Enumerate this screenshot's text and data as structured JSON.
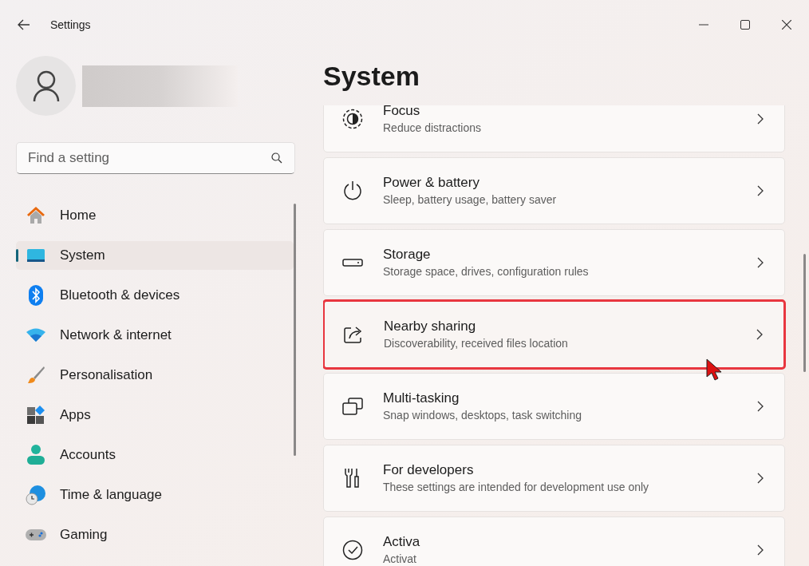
{
  "window": {
    "title": "Settings"
  },
  "search": {
    "placeholder": "Find a setting"
  },
  "sidebar": {
    "items": [
      {
        "label": "Home",
        "selected": false
      },
      {
        "label": "System",
        "selected": true
      },
      {
        "label": "Bluetooth & devices",
        "selected": false
      },
      {
        "label": "Network & internet",
        "selected": false
      },
      {
        "label": "Personalisation",
        "selected": false
      },
      {
        "label": "Apps",
        "selected": false
      },
      {
        "label": "Accounts",
        "selected": false
      },
      {
        "label": "Time & language",
        "selected": false
      },
      {
        "label": "Gaming",
        "selected": false
      }
    ]
  },
  "page": {
    "title": "System",
    "items": [
      {
        "title": "Focus",
        "subtitle": "Reduce distractions",
        "highlighted": false
      },
      {
        "title": "Power & battery",
        "subtitle": "Sleep, battery usage, battery saver",
        "highlighted": false
      },
      {
        "title": "Storage",
        "subtitle": "Storage space, drives, configuration rules",
        "highlighted": false
      },
      {
        "title": "Nearby sharing",
        "subtitle": "Discoverability, received files location",
        "highlighted": true
      },
      {
        "title": "Multi-tasking",
        "subtitle": "Snap windows, desktops, task switching",
        "highlighted": false
      },
      {
        "title": "For developers",
        "subtitle": "These settings are intended for development use only",
        "highlighted": false
      },
      {
        "title": "Activa",
        "subtitle": "Activat",
        "highlighted": false
      }
    ]
  }
}
